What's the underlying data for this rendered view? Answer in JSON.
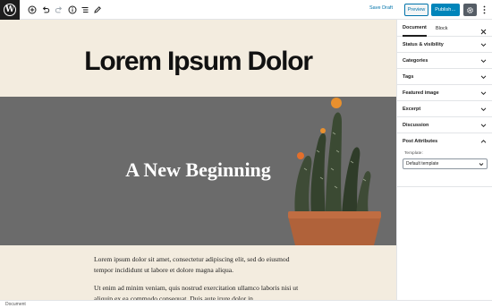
{
  "toolbar": {
    "logo_letter": "W",
    "save_draft": "Save Draft",
    "preview": "Preview",
    "publish": "Publish…",
    "icons": [
      "add-block-icon",
      "undo-icon",
      "redo-icon",
      "info-icon",
      "list-view-icon",
      "edit-icon",
      "settings-gear-icon",
      "more-menu-icon"
    ]
  },
  "post": {
    "title": "Lorem Ipsum Dolor",
    "cover_heading": "A New Beginning",
    "paragraphs": [
      "Lorem ipsum dolor sit amet, consectetur adipiscing elit, sed do eiusmod tempor incididunt ut labore et dolore magna aliqua.",
      "Ut enim ad minim veniam, quis nostrud exercitation ullamco laboris nisi ut aliquip ex ea commodo consequat. Duis aute irure dolor in"
    ]
  },
  "sidebar": {
    "tabs": [
      "Document",
      "Block"
    ],
    "active_tab": "Document",
    "panels": [
      {
        "label": "Status & visibility",
        "expanded": false
      },
      {
        "label": "Categories",
        "expanded": false
      },
      {
        "label": "Tags",
        "expanded": false
      },
      {
        "label": "Featured image",
        "expanded": false
      },
      {
        "label": "Excerpt",
        "expanded": false
      },
      {
        "label": "Discussion",
        "expanded": false
      },
      {
        "label": "Post Attributes",
        "expanded": true
      }
    ],
    "post_attributes": {
      "template_label": "Template:",
      "template_value": "Default template"
    }
  },
  "footer": {
    "breadcrumb": "Document"
  },
  "colors": {
    "accent": "#0085ba",
    "link": "#0073aa",
    "canvas_bg": "#f3ecdf",
    "cover_overlay": "#6b6b6b",
    "dark": "#1e1e1e"
  }
}
